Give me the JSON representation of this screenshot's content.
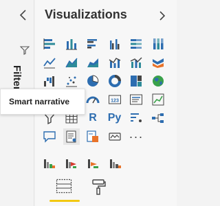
{
  "filters_pane": {
    "label": "Filters"
  },
  "viz_pane": {
    "title": "Visualizations",
    "rows": [
      [
        "stacked-bar-icon",
        "stacked-column-icon",
        "clustered-bar-icon",
        "clustered-column-icon",
        "100-stacked-bar-icon",
        "100-stacked-column-icon"
      ],
      [
        "line-chart-icon",
        "area-chart-icon",
        "stacked-area-icon",
        "line-clustered-column-icon",
        "line-stacked-column-icon",
        "ribbon-chart-icon"
      ],
      [
        "waterfall-icon",
        "scatter-icon",
        "pie-chart-icon",
        "donut-chart-icon",
        "treemap-icon",
        "map-icon"
      ],
      [
        "filled-map-icon",
        "funnel-icon",
        "gauge-icon",
        "card-icon",
        "multi-row-card-icon",
        "kpi-icon"
      ],
      [
        "slicer-icon",
        "table-icon",
        "r-visual-icon",
        "python-visual-icon",
        "key-influencers-icon",
        "decomposition-tree-icon"
      ],
      [
        "qa-icon",
        "smart-narrative-icon",
        "paginated-report-icon",
        "power-apps-icon",
        "more-visuals-icon"
      ]
    ],
    "card_value": "123",
    "r_label": "R",
    "py_label": "Py",
    "more_label": "···",
    "custom_visuals": [
      "custom-visual-1-icon",
      "custom-visual-2-icon",
      "custom-visual-3-icon",
      "custom-visual-4-icon"
    ]
  },
  "tabs": [
    {
      "name": "fields-tab",
      "active": true
    },
    {
      "name": "format-tab",
      "active": false
    }
  ],
  "tooltip": {
    "text": "Smart narrative"
  },
  "colors": {
    "accent": "#f2c811",
    "blue": "#2d6db0",
    "teal": "#2e8b99",
    "orange": "#e8732a",
    "red": "#d63b2f",
    "green": "#3aa14a"
  }
}
